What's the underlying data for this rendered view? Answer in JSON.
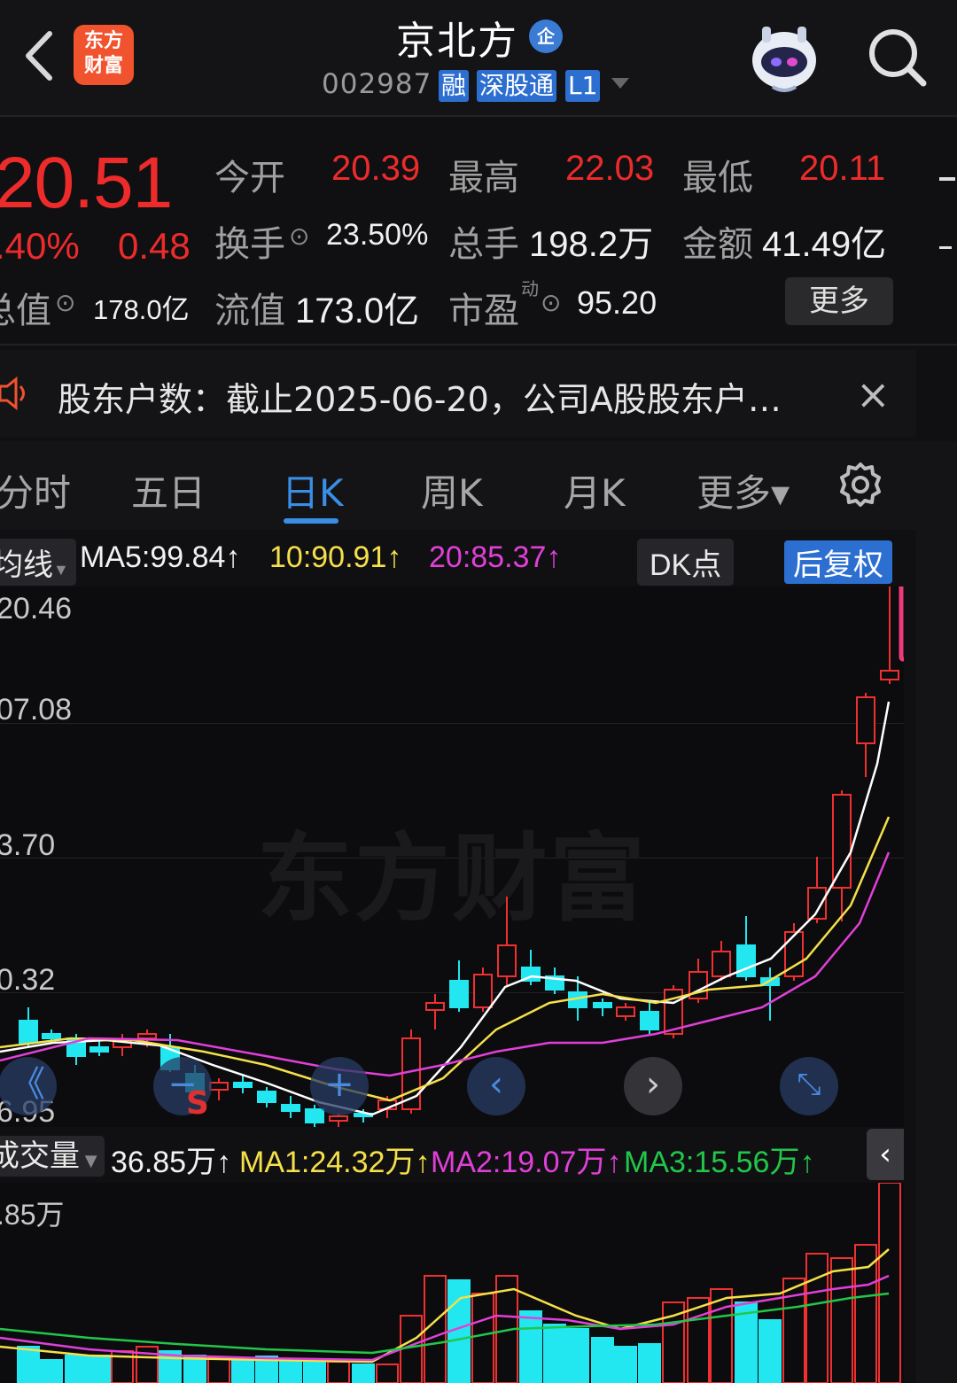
{
  "header": {
    "stock_name": "京北方",
    "enterprise_badge": "企",
    "stock_code": "002987",
    "tags": [
      "融",
      "深股通",
      "L1"
    ],
    "logo_text_line1": "东方",
    "logo_text_line2": "财富"
  },
  "quote": {
    "price": "20.51",
    "change_pct": ".40%",
    "change": "0.48",
    "open_label": "今开",
    "open": "20.39",
    "high_label": "最高",
    "high": "22.03",
    "low_label": "最低",
    "low": "20.11",
    "turnover_label": "换手",
    "turnover": "23.50%",
    "volume_label": "总手",
    "volume": "198.2万",
    "amount_label": "金额",
    "amount": "41.49亿",
    "mktcap_label": "总值",
    "mktcap": "178.0亿",
    "float_label": "流值",
    "float": "173.0亿",
    "pe_label": "市盈",
    "pe_super": "动",
    "pe": "95.20",
    "more_label": "更多",
    "circle_icon": "⊙"
  },
  "notice": {
    "text": "股东户数：截止2025-06-20，公司A股股东户…",
    "close": "×"
  },
  "tabs": {
    "items": [
      "分时",
      "五日",
      "日K",
      "周K",
      "月K",
      "更多▾"
    ],
    "active": "日K"
  },
  "kline_info": {
    "type_label": "均线",
    "ma5": "MA5:99.84↑",
    "ma10": "10:90.91↑",
    "ma20": "20:85.37↑",
    "dk_label": "DK点",
    "adjust_label": "后复权",
    "colors": {
      "ma5": "#ffffff",
      "ma10": "#f5e04a",
      "ma20": "#e040d8",
      "up": "#ee3030",
      "down": "#22e6f0"
    }
  },
  "price_axis": {
    "labels": [
      "20.46",
      "07.08",
      "3.70",
      "0.32",
      "6.95"
    ]
  },
  "watermark": "东方财富",
  "nav_buttons": [
    "《",
    "−",
    "+",
    "‹",
    "›",
    "⤡"
  ],
  "sell_marker": "S",
  "volume_info": {
    "label": "成交量",
    "value": "36.85万↑",
    "ma1": "MA1:24.32万↑",
    "ma2": "MA2:19.07万↑",
    "ma3": "MA3:15.56万↑",
    "axis_top": ".85万",
    "colors": {
      "ma1": "#f5e04a",
      "ma2": "#e040d8",
      "ma3": "#22c64a"
    }
  }
}
